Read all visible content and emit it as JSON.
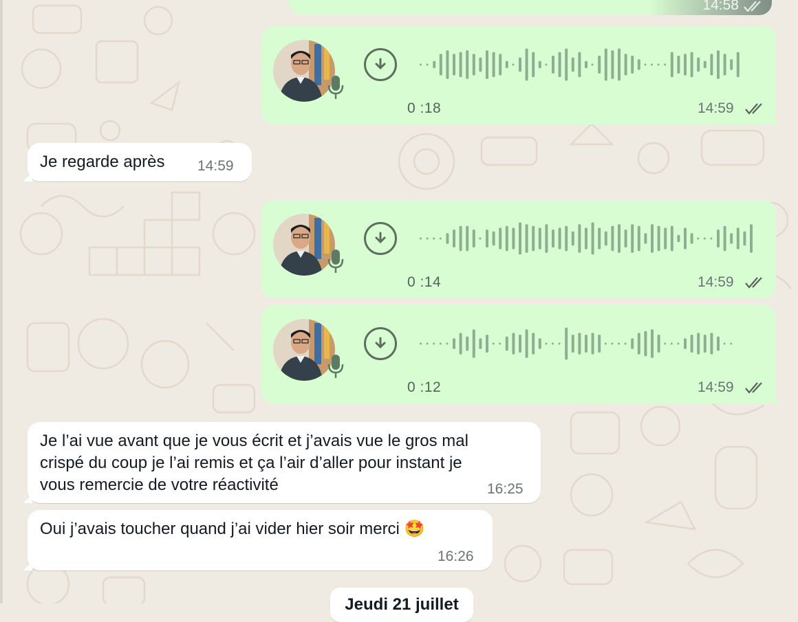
{
  "colors": {
    "background": "#efeae2",
    "outgoing_bubble": "#d9fdd3",
    "incoming_bubble": "#ffffff",
    "waveform": "#8fae91",
    "icon": "#5d6e5f"
  },
  "messages": [
    {
      "direction": "out",
      "type": "voice",
      "duration": "0 :18",
      "time": "14:59",
      "status": "read"
    },
    {
      "direction": "in",
      "type": "text",
      "text": "Je regarde après",
      "time": "14:59"
    },
    {
      "direction": "out",
      "type": "voice",
      "duration": "0 :14",
      "time": "14:59",
      "status": "read"
    },
    {
      "direction": "out",
      "type": "voice",
      "duration": "0 :12",
      "time": "14:59",
      "status": "read"
    },
    {
      "direction": "in",
      "type": "text",
      "lines": [
        "Je l’ai vue avant que je vous écrit et j’avais vue le gros mal",
        "crispé du coup je l’ai remis et ça l’air d’aller pour instant je",
        "vous remercie de votre réactivité"
      ],
      "time": "16:25"
    },
    {
      "direction": "in",
      "type": "text",
      "text": "Oui j’avais toucher quand j’ai vider hier soir merci",
      "emoji": "🤩",
      "time": "16:26"
    }
  ],
  "top_partial_time": "14:58",
  "date_separator": "Jeudi 21 juillet"
}
